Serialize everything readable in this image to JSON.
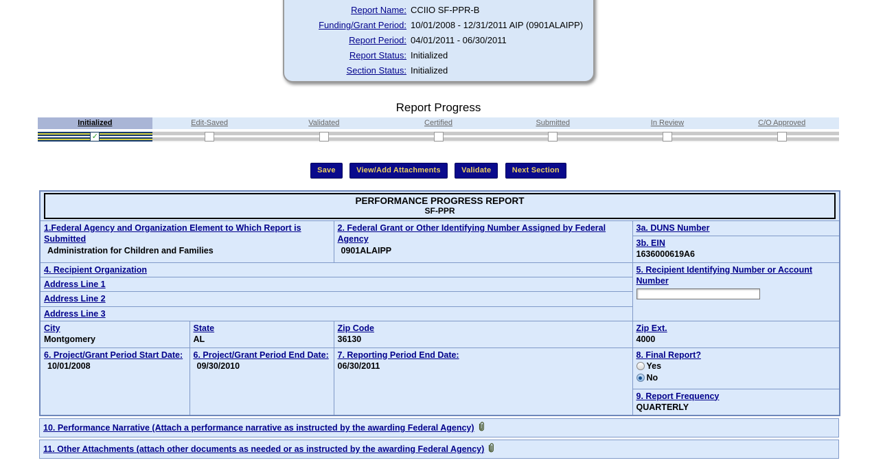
{
  "colors": {
    "accent": "#00008b",
    "cell-bg": "#dbe9fb",
    "table-border": "#8099c8",
    "btn-bg": "#0a0a8c",
    "btn-text": "#eed05e"
  },
  "info_box": {
    "fields": [
      {
        "label": "Report Name:",
        "value": "CCIIO SF-PPR-B"
      },
      {
        "label": "Funding/Grant Period:",
        "value": "10/01/2008 - 12/31/2011 AIP (0901ALAIPP)"
      },
      {
        "label": "Report Period:",
        "value": "04/01/2011 - 06/30/2011"
      },
      {
        "label": "Report Status:",
        "value": "Initialized"
      },
      {
        "label": "Section Status:",
        "value": "Initialized"
      }
    ]
  },
  "progress": {
    "title": "Report Progress",
    "stages": [
      {
        "label": "Initialized",
        "active": true,
        "checked": true
      },
      {
        "label": "Edit-Saved",
        "active": false,
        "checked": false
      },
      {
        "label": "Validated",
        "active": false,
        "checked": false
      },
      {
        "label": "Certified",
        "active": false,
        "checked": false
      },
      {
        "label": "Submitted",
        "active": false,
        "checked": false
      },
      {
        "label": "In Review",
        "active": false,
        "checked": false
      },
      {
        "label": "C/O Approved",
        "active": false,
        "checked": false
      }
    ]
  },
  "toolbar": {
    "buttons": [
      "Save",
      "View/Add Attachments",
      "Validate",
      "Next Section"
    ]
  },
  "form": {
    "title": "PERFORMANCE PROGRESS REPORT",
    "subtitle": "SF-PPR",
    "fields": {
      "federal_agency": {
        "label": "1.Federal Agency and Organization Element to Which Report is Submitted",
        "value": "Administration for Children and Families"
      },
      "federal_grant": {
        "label": "2. Federal Grant or Other Identifying Number Assigned by Federal Agency",
        "value": "0901ALAIPP"
      },
      "duns": {
        "label": "3a. DUNS Number",
        "value": ""
      },
      "ein": {
        "label": "3b. EIN",
        "value": "1636000619A6"
      },
      "recipient_org": {
        "label": "4. Recipient Organization",
        "value": ""
      },
      "address1": {
        "label": "Address Line 1",
        "value": ""
      },
      "address2": {
        "label": "Address Line 2",
        "value": ""
      },
      "address3": {
        "label": "Address Line 3",
        "value": ""
      },
      "recipient_id": {
        "label": "5. Recipient Identifying Number or Account Number",
        "value": ""
      },
      "city": {
        "label": "City",
        "value": "Montgomery"
      },
      "state": {
        "label": "State",
        "value": "AL"
      },
      "zip": {
        "label": "Zip Code",
        "value": "36130"
      },
      "zip_ext": {
        "label": "Zip Ext.",
        "value": "4000"
      },
      "period_start": {
        "label": "6. Project/Grant Period Start Date:",
        "value": "10/01/2008"
      },
      "period_end": {
        "label": "6. Project/Grant Period End Date:",
        "value": "09/30/2010"
      },
      "reporting_end": {
        "label": "7. Reporting Period End Date:",
        "value": "06/30/2011"
      },
      "final_report": {
        "label": "8. Final Report?",
        "options": [
          "Yes",
          "No"
        ],
        "selected": "No"
      },
      "frequency": {
        "label": "9. Report Frequency",
        "value": "QUARTERLY"
      },
      "narrative": {
        "label": "10. Performance Narrative (Attach a performance narrative as instructed by the awarding Federal Agency)"
      },
      "other_attachments": {
        "label": "11. Other Attachments (attach other documents as needed or as instructed by the awarding Federal Agency)"
      }
    }
  }
}
